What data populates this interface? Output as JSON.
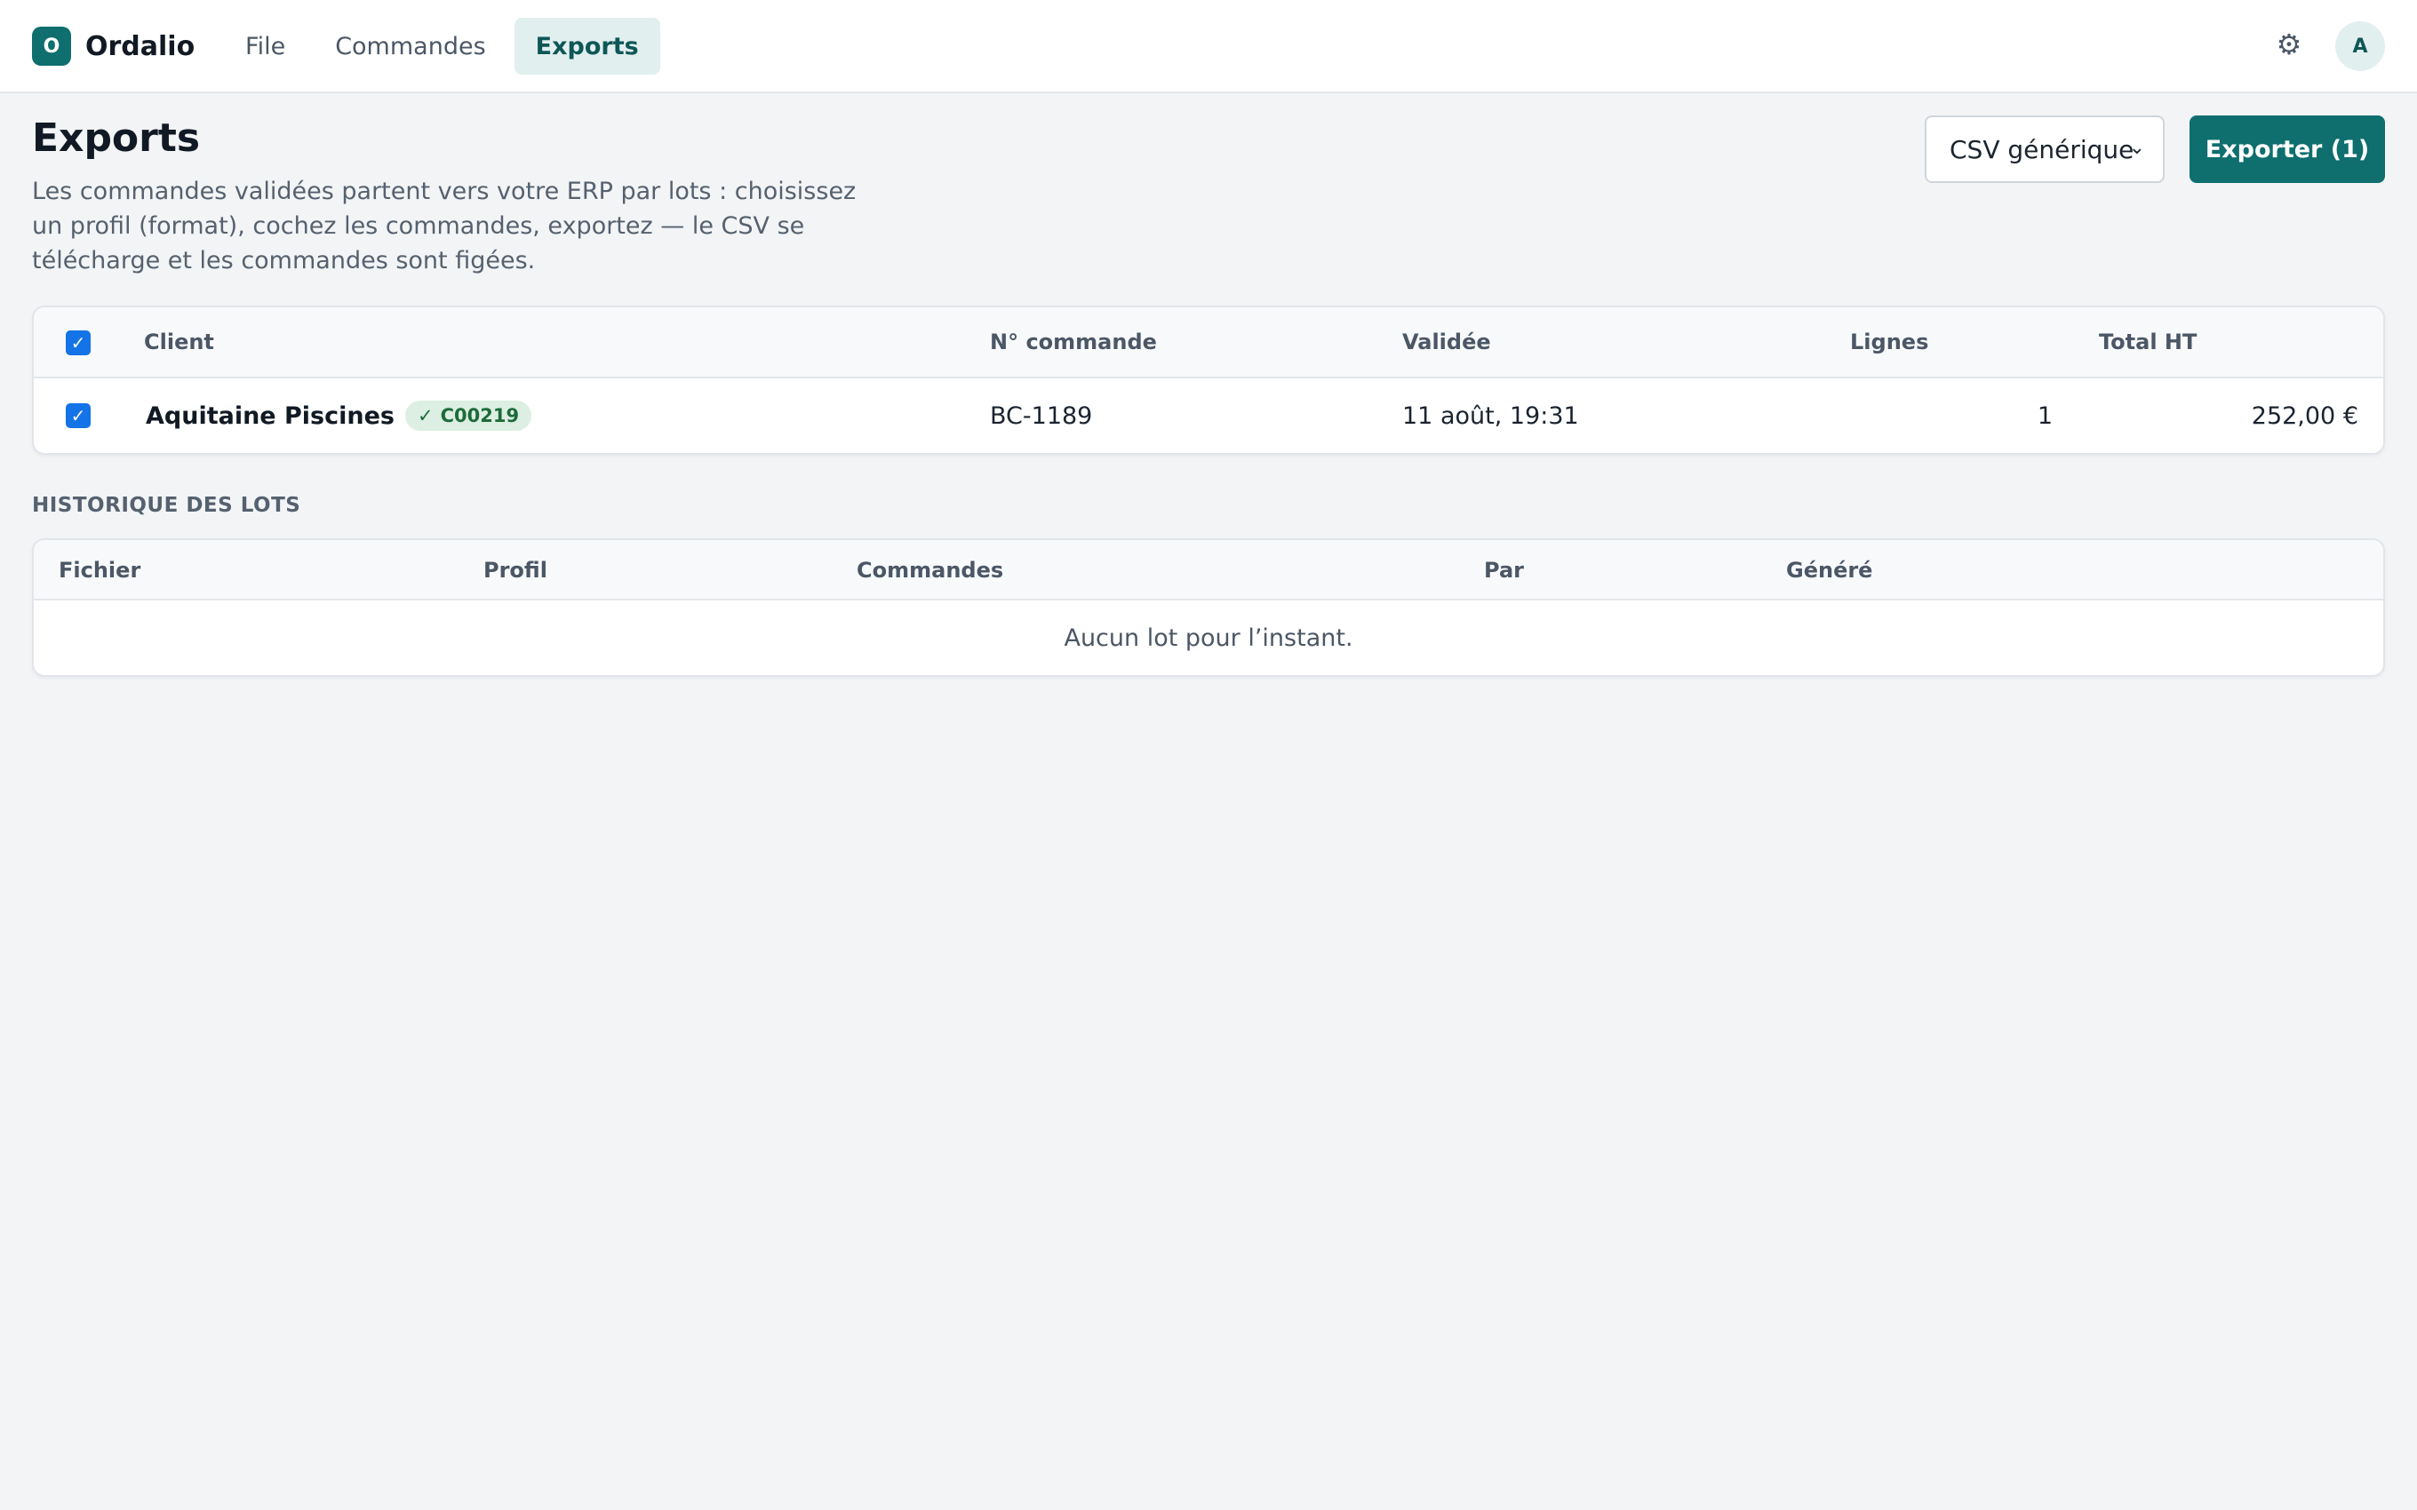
{
  "app": {
    "logo_letter": "O",
    "name": "Ordalio"
  },
  "nav": {
    "items": [
      {
        "label": "File",
        "active": false
      },
      {
        "label": "Commandes",
        "active": false
      },
      {
        "label": "Exports",
        "active": true
      }
    ]
  },
  "user": {
    "avatar_initial": "A",
    "settings_icon": "gear-icon"
  },
  "header": {
    "title": "Exports",
    "description": "Les commandes validées partent vers votre ERP par lots : choisissez un profil (format), cochez les commandes, exportez — le CSV se télécharge et les commandes sont figées.",
    "profile_select_value": "CSV générique",
    "export_button_label": "Exporter (1)"
  },
  "orders_table": {
    "columns": {
      "client": "Client",
      "order_number": "N° commande",
      "validated": "Validée",
      "lines": "Lignes",
      "total": "Total HT"
    },
    "select_all_checked": true,
    "rows": [
      {
        "checked": true,
        "client": "Aquitaine Piscines",
        "client_code_badge": "C00219",
        "order_number": "BC-1189",
        "validated": "11 août, 19:31",
        "lines": "1",
        "total": "252,00 €"
      }
    ]
  },
  "history": {
    "section_label": "HISTORIQUE DES LOTS",
    "columns": {
      "file": "Fichier",
      "profile": "Profil",
      "orders": "Commandes",
      "by": "Par",
      "generated": "Généré"
    },
    "empty_message": "Aucun lot pour l’instant."
  },
  "colors": {
    "brand": "#0f6e6e",
    "nav_active_bg": "#e2efef",
    "checkbox": "#1473e6",
    "badge_bg": "#dcefe2",
    "badge_text": "#1d6b3a"
  }
}
